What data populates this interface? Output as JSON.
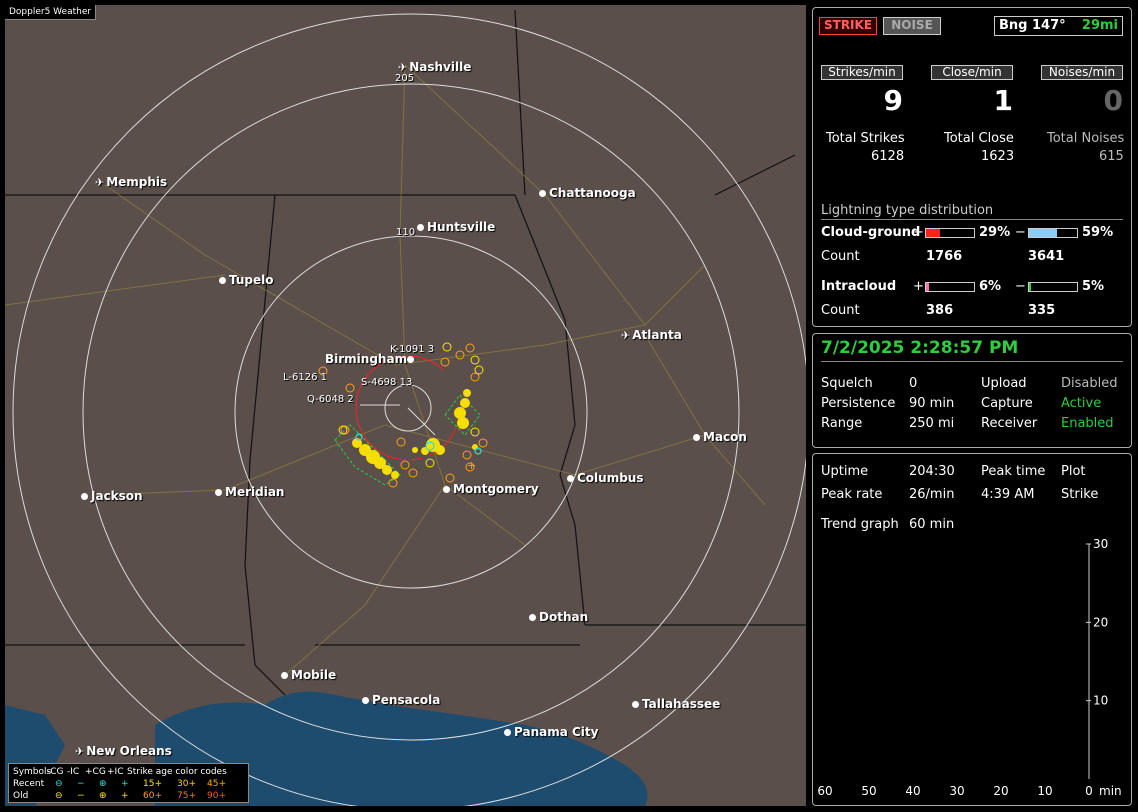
{
  "map": {
    "title": "Doppler5 Weather",
    "cities": [
      {
        "name": "Nashville",
        "type": "plane"
      },
      {
        "name": "Memphis",
        "type": "plane"
      },
      {
        "name": "Chattanooga",
        "type": "dot"
      },
      {
        "name": "Huntsville",
        "type": "dot"
      },
      {
        "name": "Tupelo",
        "type": "dot"
      },
      {
        "name": "Atlanta",
        "type": "plane"
      },
      {
        "name": "Birmingham",
        "type": "dot"
      },
      {
        "name": "Macon",
        "type": "dot"
      },
      {
        "name": "Columbus",
        "type": "dot"
      },
      {
        "name": "Montgomery",
        "type": "dot"
      },
      {
        "name": "Jackson",
        "type": "dot"
      },
      {
        "name": "Meridian",
        "type": "dot"
      },
      {
        "name": "Dothan",
        "type": "dot"
      },
      {
        "name": "Mobile",
        "type": "dot"
      },
      {
        "name": "Pensacola",
        "type": "dot"
      },
      {
        "name": "Tallahassee",
        "type": "dot"
      },
      {
        "name": "Panama City",
        "type": "dot"
      },
      {
        "name": "New Orleans",
        "type": "plane"
      }
    ],
    "range_labels": [
      "205",
      "110"
    ],
    "strike_labels": [
      "K-1091 3",
      "L-6126 1",
      "S-4698 13",
      "Q-6048 2"
    ],
    "legend": {
      "header": [
        "Symbols",
        "-CG",
        "-IC",
        "+CG",
        "+IC",
        "Strike age color codes"
      ],
      "recent_label": "Recent",
      "old_label": "Old",
      "recent_ages": [
        "15+",
        "30+",
        "45+"
      ],
      "old_ages": [
        "60+",
        "75+",
        "90+"
      ]
    }
  },
  "status": {
    "strike_btn": "STRIKE",
    "noise_btn": "NOISE",
    "bearing": "Bng 147°",
    "distance": "29mi",
    "strikes_per_min_label": "Strikes/min",
    "close_per_min_label": "Close/min",
    "noises_per_min_label": "Noises/min",
    "strikes_per_min": "9",
    "close_per_min": "1",
    "noises_per_min": "0",
    "total_strikes_label": "Total Strikes",
    "total_close_label": "Total Close",
    "total_noises_label": "Total Noises",
    "total_strikes": "6128",
    "total_close": "1623",
    "total_noises": "615",
    "dist_title": "Lightning type distribution",
    "cg_label": "Cloud-ground",
    "ic_label": "Intracloud",
    "count_label": "Count",
    "cg_pos_pct": "29%",
    "cg_neg_pct": "59%",
    "cg_pos_count": "1766",
    "cg_neg_count": "3641",
    "ic_pos_pct": "6%",
    "ic_neg_pct": "5%",
    "ic_pos_count": "386",
    "ic_neg_count": "335",
    "cg_pos_frac": 0.29,
    "cg_neg_frac": 0.59,
    "ic_pos_frac": 0.06,
    "ic_neg_frac": 0.05
  },
  "settings": {
    "datetime": "7/2/2025 2:28:57 PM",
    "squelch_label": "Squelch",
    "squelch": "0",
    "persistence_label": "Persistence",
    "persistence": "90 min",
    "range_label": "Range",
    "range": "250 mi",
    "upload_label": "Upload",
    "upload": "Disabled",
    "capture_label": "Capture",
    "capture": "Active",
    "receiver_label": "Receiver",
    "receiver": "Enabled"
  },
  "stats": {
    "uptime_label": "Uptime",
    "uptime": "204:30",
    "peak_time_label": "Peak time",
    "plot_label": "Plot",
    "peak_rate_label": "Peak rate",
    "peak_rate": "26/min",
    "peak_time": "4:39 AM",
    "plot": "Strike",
    "trend_label": "Trend graph",
    "trend": "60 min"
  },
  "chart_data": {
    "type": "line",
    "x_ticks": [
      "60",
      "50",
      "40",
      "30",
      "20",
      "10",
      "0"
    ],
    "x_unit": "min",
    "y_ticks": [
      "30",
      "20",
      "10"
    ],
    "ylim": [
      0,
      30
    ],
    "xlim": [
      60,
      0
    ]
  },
  "colors": {
    "green": "#2ecc40",
    "strike_red": "#ff2020",
    "ic_blue": "#8ecbf5"
  }
}
